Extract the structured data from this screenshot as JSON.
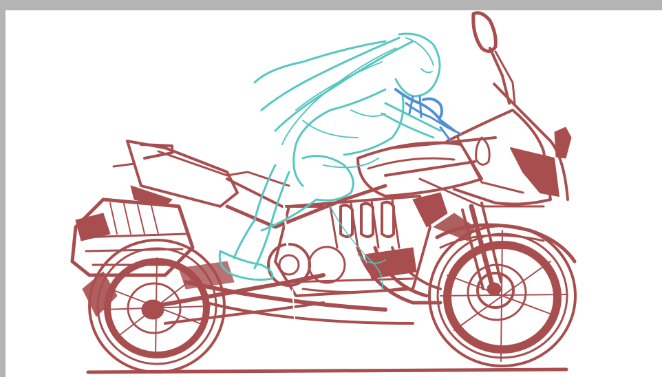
{
  "canvas": {
    "background": "#ffffff",
    "frame_color": "#b4b4b4"
  },
  "artwork": {
    "subjects": [
      "motorcycle",
      "rider"
    ],
    "colors": {
      "motorcycle": "#a84e4e",
      "rider": "#57c7c1",
      "rider_accent": "#4f8fd6"
    }
  }
}
